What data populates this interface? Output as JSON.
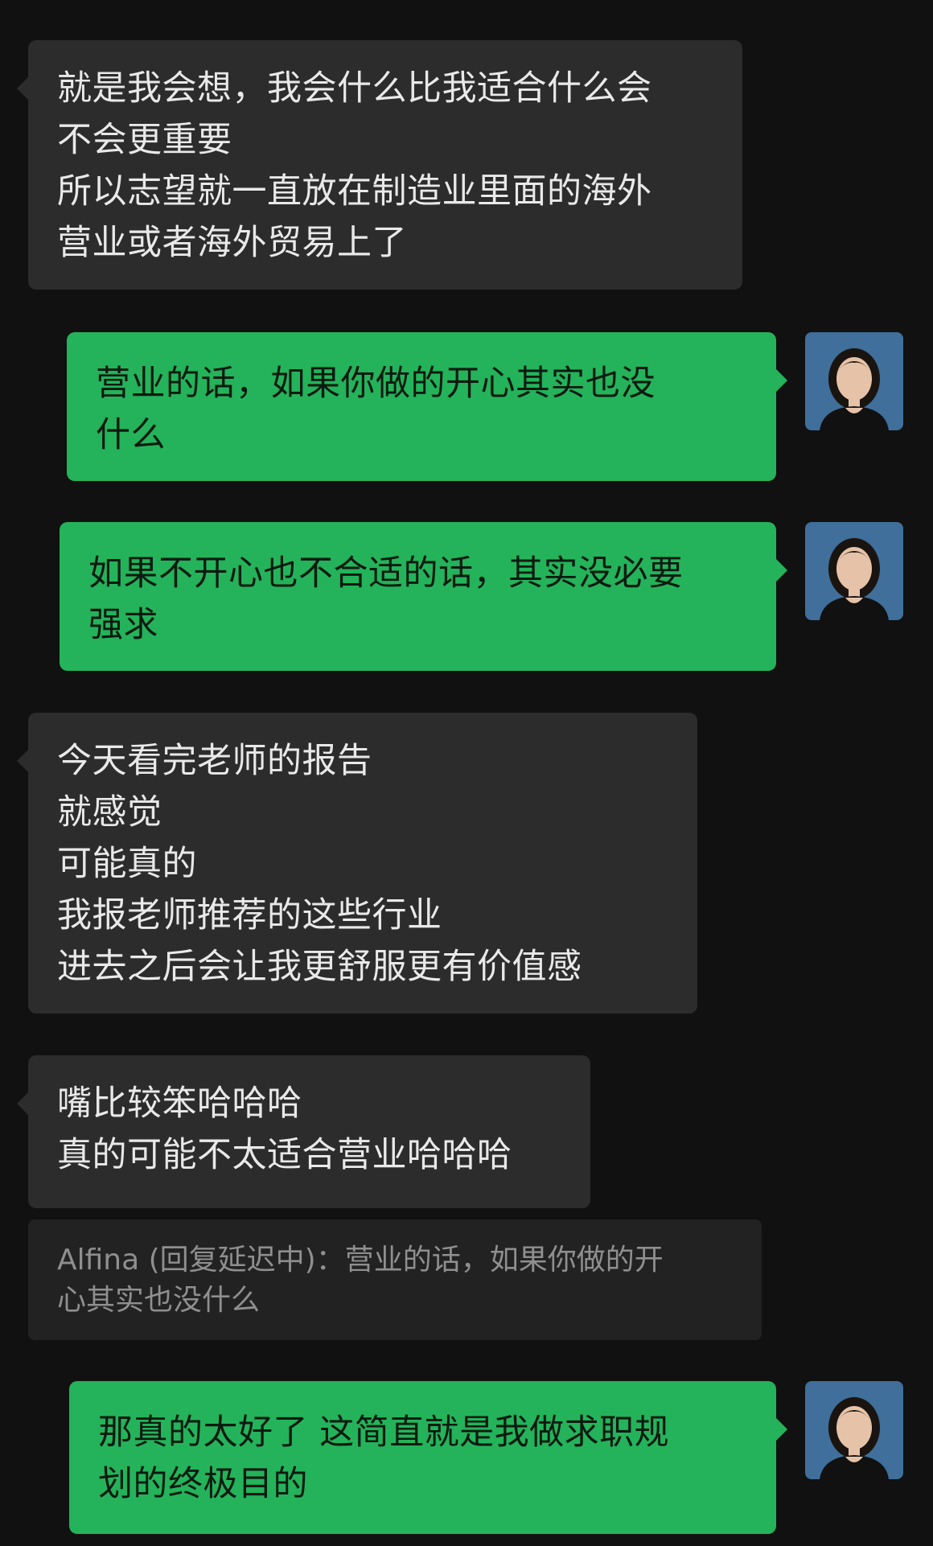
{
  "messages": [
    {
      "side": "incoming",
      "text": "就是我会想，我会什么比我适合什么会\n不会更重要\n所以志望就一直放在制造业里面的海外\n营业或者海外贸易上了"
    },
    {
      "side": "outgoing",
      "text": "营业的话，如果你做的开心其实也没\n什么"
    },
    {
      "side": "outgoing",
      "text": "如果不开心也不合适的话，其实没必要\n强求"
    },
    {
      "side": "incoming",
      "text": "今天看完老师的报告\n就感觉\n可能真的\n我报老师推荐的这些行业\n进去之后会让我更舒服更有价值感"
    },
    {
      "side": "incoming",
      "text": "嘴比较笨哈哈哈\n真的可能不太适合营业哈哈哈"
    },
    {
      "side": "outgoing",
      "text": "那真的太好了 这简直就是我做求职规\n划的终极目的"
    }
  ],
  "quote": {
    "text": "Alfina (回复延迟中)：营业的话，如果你做的开\n心其实也没什么"
  },
  "avatar": {
    "icon": "user-avatar-photo",
    "background": "#3f6f9a",
    "hair": "#1a1410",
    "skin": "#e6c3a8",
    "top": "#111111"
  },
  "colors": {
    "background": "#111111",
    "incoming_bubble": "#2c2c2c",
    "outgoing_bubble": "#24b35a"
  }
}
